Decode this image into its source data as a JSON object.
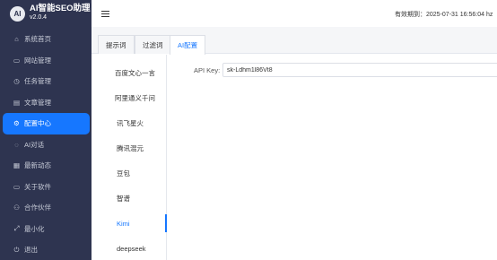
{
  "app": {
    "logo_text": "AI",
    "name": "AI智能SEO助理",
    "version": "v2.0.4"
  },
  "sidebar": {
    "items": [
      {
        "label": "系统首页",
        "icon": "⌂"
      },
      {
        "label": "网站管理",
        "icon": "▭"
      },
      {
        "label": "任务管理",
        "icon": "◷"
      },
      {
        "label": "文章管理",
        "icon": "▤"
      },
      {
        "label": "配置中心",
        "icon": "⚙",
        "active": true
      },
      {
        "label": "AI对话",
        "icon": "◌"
      },
      {
        "label": "最新动态",
        "icon": "▦"
      },
      {
        "label": "关于软件",
        "icon": "▭"
      },
      {
        "label": "合作伙伴",
        "icon": "⚇"
      },
      {
        "label": "最小化",
        "icon": "⤢"
      },
      {
        "label": "退出",
        "icon": "⏻"
      }
    ]
  },
  "header": {
    "menu_icon": "hamburger-icon",
    "expiry_text": "有效期到：2025-07-31 16:56:04  hz"
  },
  "tabs": [
    {
      "label": "提示词"
    },
    {
      "label": "过滤词"
    },
    {
      "label": "AI配置",
      "active": true
    }
  ],
  "models": [
    {
      "label": "百度文心一言"
    },
    {
      "label": "阿里通义千问"
    },
    {
      "label": "讯飞星火"
    },
    {
      "label": "腾讯混元"
    },
    {
      "label": "豆包"
    },
    {
      "label": "智谱"
    },
    {
      "label": "Kimi",
      "active": true
    },
    {
      "label": "deepseek"
    }
  ],
  "form": {
    "api_key_label": "API Key:",
    "api_key_value": "sk-Ldhm1l86Vt8"
  },
  "colors": {
    "sidebar_bg": "#2e3450",
    "accent": "#1677ff"
  }
}
